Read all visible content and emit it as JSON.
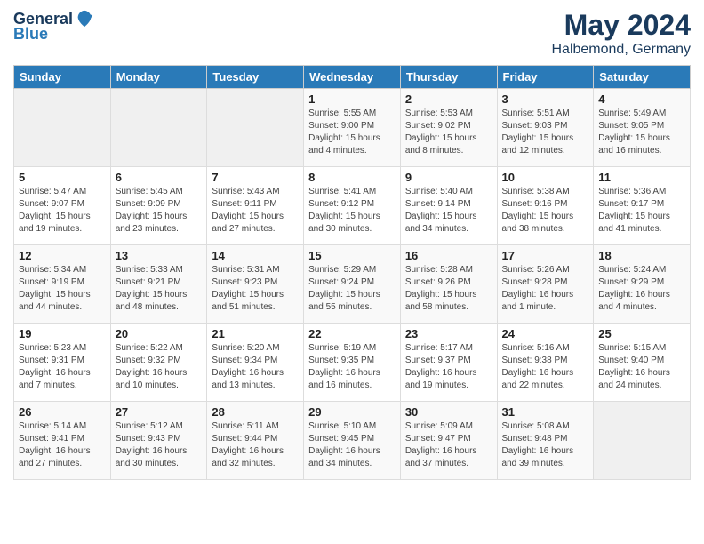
{
  "logo": {
    "general": "General",
    "blue": "Blue"
  },
  "header": {
    "month_year": "May 2024",
    "location": "Halbemond, Germany"
  },
  "weekdays": [
    "Sunday",
    "Monday",
    "Tuesday",
    "Wednesday",
    "Thursday",
    "Friday",
    "Saturday"
  ],
  "weeks": [
    [
      {
        "day": "",
        "sunrise": "",
        "sunset": "",
        "daylight": "",
        "empty": true
      },
      {
        "day": "",
        "sunrise": "",
        "sunset": "",
        "daylight": "",
        "empty": true
      },
      {
        "day": "",
        "sunrise": "",
        "sunset": "",
        "daylight": "",
        "empty": true
      },
      {
        "day": "1",
        "sunrise": "Sunrise: 5:55 AM",
        "sunset": "Sunset: 9:00 PM",
        "daylight": "Daylight: 15 hours and 4 minutes."
      },
      {
        "day": "2",
        "sunrise": "Sunrise: 5:53 AM",
        "sunset": "Sunset: 9:02 PM",
        "daylight": "Daylight: 15 hours and 8 minutes."
      },
      {
        "day": "3",
        "sunrise": "Sunrise: 5:51 AM",
        "sunset": "Sunset: 9:03 PM",
        "daylight": "Daylight: 15 hours and 12 minutes."
      },
      {
        "day": "4",
        "sunrise": "Sunrise: 5:49 AM",
        "sunset": "Sunset: 9:05 PM",
        "daylight": "Daylight: 15 hours and 16 minutes."
      }
    ],
    [
      {
        "day": "5",
        "sunrise": "Sunrise: 5:47 AM",
        "sunset": "Sunset: 9:07 PM",
        "daylight": "Daylight: 15 hours and 19 minutes."
      },
      {
        "day": "6",
        "sunrise": "Sunrise: 5:45 AM",
        "sunset": "Sunset: 9:09 PM",
        "daylight": "Daylight: 15 hours and 23 minutes."
      },
      {
        "day": "7",
        "sunrise": "Sunrise: 5:43 AM",
        "sunset": "Sunset: 9:11 PM",
        "daylight": "Daylight: 15 hours and 27 minutes."
      },
      {
        "day": "8",
        "sunrise": "Sunrise: 5:41 AM",
        "sunset": "Sunset: 9:12 PM",
        "daylight": "Daylight: 15 hours and 30 minutes."
      },
      {
        "day": "9",
        "sunrise": "Sunrise: 5:40 AM",
        "sunset": "Sunset: 9:14 PM",
        "daylight": "Daylight: 15 hours and 34 minutes."
      },
      {
        "day": "10",
        "sunrise": "Sunrise: 5:38 AM",
        "sunset": "Sunset: 9:16 PM",
        "daylight": "Daylight: 15 hours and 38 minutes."
      },
      {
        "day": "11",
        "sunrise": "Sunrise: 5:36 AM",
        "sunset": "Sunset: 9:17 PM",
        "daylight": "Daylight: 15 hours and 41 minutes."
      }
    ],
    [
      {
        "day": "12",
        "sunrise": "Sunrise: 5:34 AM",
        "sunset": "Sunset: 9:19 PM",
        "daylight": "Daylight: 15 hours and 44 minutes."
      },
      {
        "day": "13",
        "sunrise": "Sunrise: 5:33 AM",
        "sunset": "Sunset: 9:21 PM",
        "daylight": "Daylight: 15 hours and 48 minutes."
      },
      {
        "day": "14",
        "sunrise": "Sunrise: 5:31 AM",
        "sunset": "Sunset: 9:23 PM",
        "daylight": "Daylight: 15 hours and 51 minutes."
      },
      {
        "day": "15",
        "sunrise": "Sunrise: 5:29 AM",
        "sunset": "Sunset: 9:24 PM",
        "daylight": "Daylight: 15 hours and 55 minutes."
      },
      {
        "day": "16",
        "sunrise": "Sunrise: 5:28 AM",
        "sunset": "Sunset: 9:26 PM",
        "daylight": "Daylight: 15 hours and 58 minutes."
      },
      {
        "day": "17",
        "sunrise": "Sunrise: 5:26 AM",
        "sunset": "Sunset: 9:28 PM",
        "daylight": "Daylight: 16 hours and 1 minute."
      },
      {
        "day": "18",
        "sunrise": "Sunrise: 5:24 AM",
        "sunset": "Sunset: 9:29 PM",
        "daylight": "Daylight: 16 hours and 4 minutes."
      }
    ],
    [
      {
        "day": "19",
        "sunrise": "Sunrise: 5:23 AM",
        "sunset": "Sunset: 9:31 PM",
        "daylight": "Daylight: 16 hours and 7 minutes."
      },
      {
        "day": "20",
        "sunrise": "Sunrise: 5:22 AM",
        "sunset": "Sunset: 9:32 PM",
        "daylight": "Daylight: 16 hours and 10 minutes."
      },
      {
        "day": "21",
        "sunrise": "Sunrise: 5:20 AM",
        "sunset": "Sunset: 9:34 PM",
        "daylight": "Daylight: 16 hours and 13 minutes."
      },
      {
        "day": "22",
        "sunrise": "Sunrise: 5:19 AM",
        "sunset": "Sunset: 9:35 PM",
        "daylight": "Daylight: 16 hours and 16 minutes."
      },
      {
        "day": "23",
        "sunrise": "Sunrise: 5:17 AM",
        "sunset": "Sunset: 9:37 PM",
        "daylight": "Daylight: 16 hours and 19 minutes."
      },
      {
        "day": "24",
        "sunrise": "Sunrise: 5:16 AM",
        "sunset": "Sunset: 9:38 PM",
        "daylight": "Daylight: 16 hours and 22 minutes."
      },
      {
        "day": "25",
        "sunrise": "Sunrise: 5:15 AM",
        "sunset": "Sunset: 9:40 PM",
        "daylight": "Daylight: 16 hours and 24 minutes."
      }
    ],
    [
      {
        "day": "26",
        "sunrise": "Sunrise: 5:14 AM",
        "sunset": "Sunset: 9:41 PM",
        "daylight": "Daylight: 16 hours and 27 minutes."
      },
      {
        "day": "27",
        "sunrise": "Sunrise: 5:12 AM",
        "sunset": "Sunset: 9:43 PM",
        "daylight": "Daylight: 16 hours and 30 minutes."
      },
      {
        "day": "28",
        "sunrise": "Sunrise: 5:11 AM",
        "sunset": "Sunset: 9:44 PM",
        "daylight": "Daylight: 16 hours and 32 minutes."
      },
      {
        "day": "29",
        "sunrise": "Sunrise: 5:10 AM",
        "sunset": "Sunset: 9:45 PM",
        "daylight": "Daylight: 16 hours and 34 minutes."
      },
      {
        "day": "30",
        "sunrise": "Sunrise: 5:09 AM",
        "sunset": "Sunset: 9:47 PM",
        "daylight": "Daylight: 16 hours and 37 minutes."
      },
      {
        "day": "31",
        "sunrise": "Sunrise: 5:08 AM",
        "sunset": "Sunset: 9:48 PM",
        "daylight": "Daylight: 16 hours and 39 minutes."
      },
      {
        "day": "",
        "sunrise": "",
        "sunset": "",
        "daylight": "",
        "empty": true
      }
    ]
  ]
}
